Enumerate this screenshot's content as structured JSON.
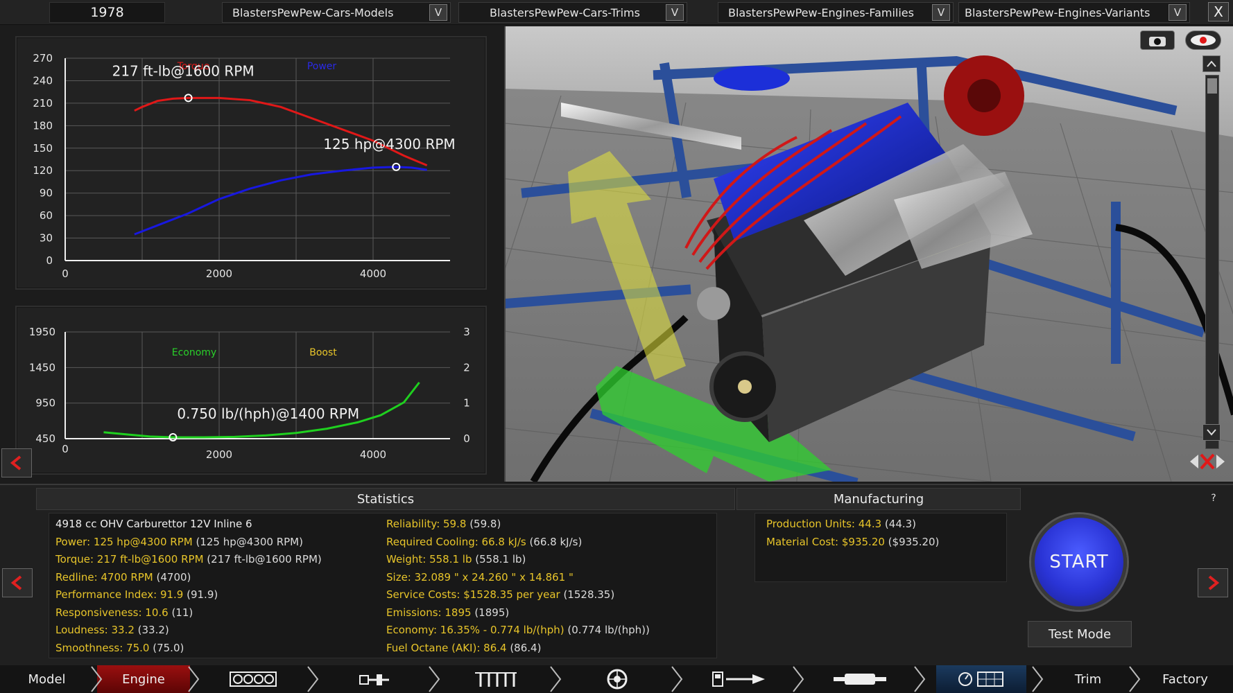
{
  "top_bar": {
    "year": "1978",
    "dropdowns": [
      {
        "label": "BlastersPewPew-Cars-Models",
        "button": "V"
      },
      {
        "label": "BlastersPewPew-Cars-Trims",
        "button": "V"
      },
      {
        "label": "BlastersPewPew-Engines-Families",
        "button": "V"
      },
      {
        "label": "BlastersPewPew-Engines-Variants",
        "button": "V"
      }
    ],
    "close_label": "X"
  },
  "chart_data": [
    {
      "type": "line",
      "x_ticks": [
        "0",
        "2000",
        "4000"
      ],
      "y_ticks": [
        "0",
        "30",
        "60",
        "90",
        "120",
        "150",
        "180",
        "210",
        "240",
        "270"
      ],
      "xlim": [
        0,
        5000
      ],
      "ylim": [
        0,
        270
      ],
      "grid": true,
      "legend": [
        "Torque",
        "Power"
      ],
      "series": [
        {
          "name": "Torque",
          "color": "#e01818",
          "x": [
            900,
            1000,
            1200,
            1400,
            1600,
            1800,
            2000,
            2400,
            2800,
            3200,
            3600,
            4000,
            4400,
            4700
          ],
          "y": [
            200,
            205,
            213,
            216,
            217,
            217,
            217,
            214,
            205,
            190,
            175,
            160,
            140,
            127
          ]
        },
        {
          "name": "Power",
          "color": "#1818e0",
          "x": [
            900,
            1200,
            1600,
            2000,
            2400,
            2800,
            3200,
            3600,
            4000,
            4300,
            4500,
            4700
          ],
          "y": [
            35,
            47,
            63,
            82,
            96,
            107,
            115,
            120,
            124,
            125,
            124,
            121
          ]
        }
      ],
      "annotations": [
        {
          "text": "217 ft-lb@1600 RPM",
          "x": 1600,
          "y": 217
        },
        {
          "text": "125 hp@4300 RPM",
          "x": 4300,
          "y": 125
        }
      ]
    },
    {
      "type": "line",
      "x_ticks": [
        "0",
        "2000",
        "4000"
      ],
      "y_ticks_left": [
        "450",
        "950",
        "1450",
        "1950"
      ],
      "y_ticks_right": [
        "0",
        "1",
        "2",
        "3"
      ],
      "xlim": [
        0,
        5000
      ],
      "ylim_left": [
        450,
        1950
      ],
      "ylim_right": [
        0,
        3
      ],
      "grid": true,
      "legend": [
        "Economy",
        "Boost"
      ],
      "series": [
        {
          "name": "Economy",
          "color": "#1fd01f",
          "x": [
            500,
            800,
            1100,
            1400,
            1800,
            2200,
            2600,
            3000,
            3400,
            3800,
            4100,
            4400,
            4600
          ],
          "y": [
            540,
            510,
            480,
            470,
            470,
            475,
            495,
            530,
            590,
            680,
            780,
            960,
            1240
          ]
        }
      ],
      "annotations": [
        {
          "text": "0.750 lb/(hph)@1400 RPM",
          "x": 1400,
          "y": 470
        }
      ]
    }
  ],
  "statistics": {
    "title": "Statistics",
    "left": [
      {
        "key": "4918 cc OHV Carburettor 12V Inline 6",
        "value": "",
        "white": true
      },
      {
        "key": "Power: 125 hp@4300 RPM",
        "value": "(125 hp@4300 RPM)"
      },
      {
        "key": "Torque: 217 ft-lb@1600 RPM",
        "value": "(217 ft-lb@1600 RPM)"
      },
      {
        "key": "Redline: 4700 RPM",
        "value": "(4700)"
      },
      {
        "key": "Performance Index: 91.9",
        "value": "(91.9)"
      },
      {
        "key": "Responsiveness: 10.6",
        "value": "(11)"
      },
      {
        "key": "Loudness: 33.2",
        "value": "(33.2)"
      },
      {
        "key": "Smoothness: 75.0",
        "value": "(75.0)"
      }
    ],
    "right": [
      {
        "key": "Reliability: 59.8",
        "value": "(59.8)"
      },
      {
        "key": "Required Cooling: 66.8 kJ/s",
        "value": "(66.8 kJ/s)"
      },
      {
        "key": "Weight: 558.1 lb",
        "value": "(558.1 lb)"
      },
      {
        "key": "Size: 32.089 \" x 24.260 \" x 14.861 \"",
        "value": ""
      },
      {
        "key": "Service Costs: $1528.35 per year",
        "value": "(1528.35)"
      },
      {
        "key": "Emissions: 1895",
        "value": "(1895)"
      },
      {
        "key": "Economy: 16.35% - 0.774 lb/(hph)",
        "value": "(0.774 lb/(hph))"
      },
      {
        "key": "Fuel Octane (AKI): 86.4",
        "value": "(86.4)"
      }
    ]
  },
  "manufacturing": {
    "title": "Manufacturing",
    "items": [
      {
        "key": "Production Units: 44.3",
        "value": "(44.3)"
      },
      {
        "key": "Material Cost: $935.20",
        "value": "($935.20)"
      }
    ]
  },
  "actions": {
    "start": "START",
    "test_mode": "Test Mode",
    "help": "?"
  },
  "nav": {
    "model": "Model",
    "engine": "Engine",
    "trim": "Trim",
    "factory": "Factory"
  }
}
